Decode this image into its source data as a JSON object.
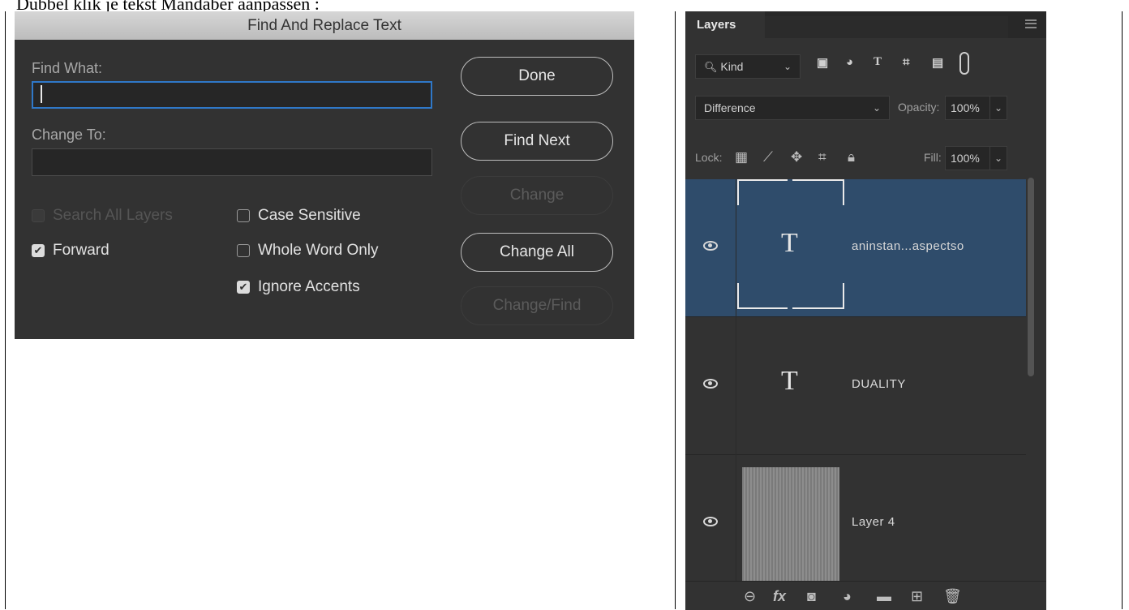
{
  "doc": {
    "caption": "Dubbel klik je tekst Mandaber aanpassen :"
  },
  "dialog": {
    "title": "Find And Replace Text",
    "find_label": "Find What:",
    "find_value": "",
    "change_label": "Change To:",
    "change_value": "",
    "buttons": {
      "done": "Done",
      "find_next": "Find Next",
      "change": "Change",
      "change_all": "Change All",
      "change_find": "Change/Find"
    },
    "checkboxes": {
      "search_all_layers": {
        "label": "Search All Layers",
        "checked": false,
        "enabled": false
      },
      "case_sensitive": {
        "label": "Case Sensitive",
        "checked": false,
        "enabled": true
      },
      "forward": {
        "label": "Forward",
        "checked": true,
        "enabled": true
      },
      "whole_word_only": {
        "label": "Whole Word Only",
        "checked": false,
        "enabled": true
      },
      "ignore_accents": {
        "label": "Ignore Accents",
        "checked": true,
        "enabled": true
      }
    }
  },
  "layers_panel": {
    "tab": "Layers",
    "filter": {
      "value": "Kind"
    },
    "blend_mode": "Difference",
    "opacity_label": "Opacity:",
    "opacity_value": "100%",
    "lock_label": "Lock:",
    "fill_label": "Fill:",
    "fill_value": "100%",
    "layers": [
      {
        "name": "aninstan...aspectso",
        "type": "text",
        "selected": true
      },
      {
        "name": "DUALITY",
        "type": "text",
        "selected": false
      },
      {
        "name": "Layer 4",
        "type": "image",
        "selected": false
      }
    ],
    "footer_icons": [
      "link-icon",
      "fx-icon",
      "mask-icon",
      "adjustment-icon",
      "folder-icon",
      "new-layer-icon",
      "trash-icon"
    ]
  }
}
